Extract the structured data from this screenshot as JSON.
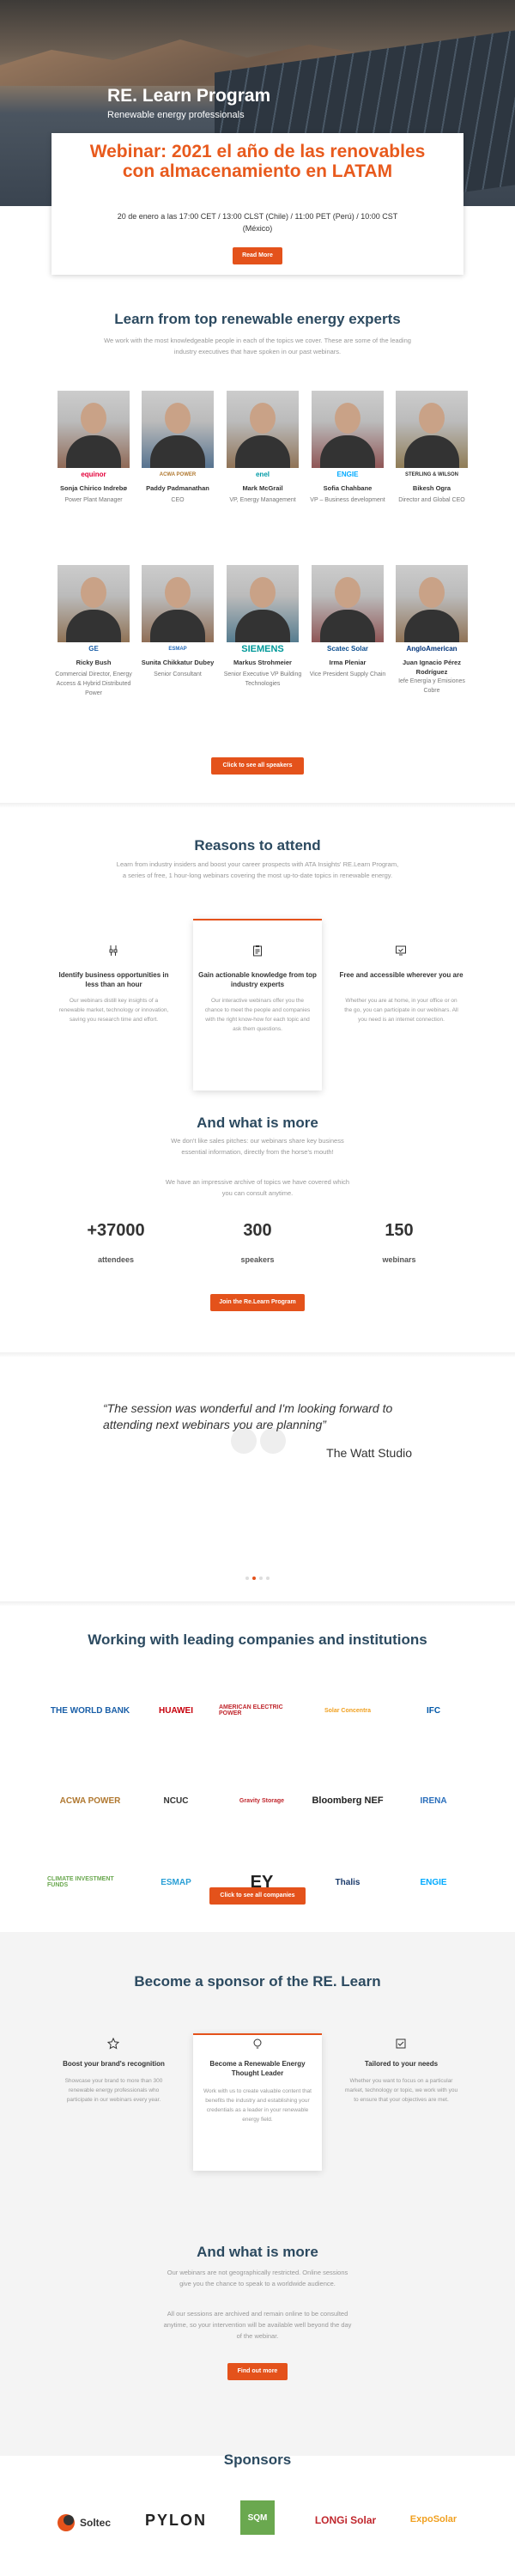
{
  "hero": {
    "title": "RE. Learn Program",
    "subtitle": "Renewable energy professionals"
  },
  "webinar": {
    "title": "Webinar: 2021 el año de las renovables con almacenamiento en LATAM",
    "time": "20 de enero a las 17:00 CET / 13:00 CLST (Chile) / 11:00 PET (Perú) / 10:00 CST (México)",
    "cta": "Read More"
  },
  "experts": {
    "title": "Learn from top renewable energy experts",
    "desc": "We work with the most knowledgeable people in each of the topics we cover. These are some of the leading industry executives that have spoken in our past webinars.",
    "cta": "Click to see all speakers",
    "row1": [
      {
        "name": "Sonja Chirico Indrebø",
        "role": "Power Plant Manager",
        "logo": "equinor"
      },
      {
        "name": "Paddy Padmanathan",
        "role": "CEO",
        "logo": "ACWA POWER"
      },
      {
        "name": "Mark McGrail",
        "role": "VP, Energy Management",
        "logo": "enel"
      },
      {
        "name": "Sofia Chahbane",
        "role": "VP – Business development",
        "logo": "ENGIE"
      },
      {
        "name": "Bikesh Ogra",
        "role": "Director and Global CEO",
        "logo": "STERLING & WILSON"
      }
    ],
    "row2": [
      {
        "name": "Ricky Bush",
        "role": "Commercial Director, Energy Access & Hybrid Distributed Power",
        "logo": "GE"
      },
      {
        "name": "Sunita Chikkatur Dubey",
        "role": "Senior Consultant",
        "logo": "ESMAP"
      },
      {
        "name": "Markus Strohmeier",
        "role": "Senior Executive VP Building Technologies",
        "logo": "SIEMENS"
      },
      {
        "name": "Irma Pleniar",
        "role": "Vice President Supply Chain",
        "logo": "Scatec Solar"
      },
      {
        "name": "Juan Ignacio Pérez Rodríguez",
        "role": "Iefe Energía y Emisiones Cobre",
        "logo": "AngloAmerican"
      }
    ]
  },
  "reasons": {
    "title": "Reasons to attend",
    "desc": "Learn from industry insiders and boost your career prospects with ATA Insights' RE.Learn Program, a series of free, 1 hour-long webinars covering the most up-to-date topics in renewable energy.",
    "cards": [
      {
        "icon": "cables-icon",
        "title": "Identify business opportunities in less than an hour",
        "desc": "Our webinars distill key insights of a renewable market, technology or innovation, saving you research time and effort."
      },
      {
        "icon": "clipboard-icon",
        "title": "Gain actionable knowledge from top industry experts",
        "desc": "Our interactive webinars offer you the chance to meet the people and companies with the right know-how for each topic and ask them questions."
      },
      {
        "icon": "monitor-check-icon",
        "title": "Free and accessible wherever you are",
        "desc": "Whether you are at home, in your office or on the go, you can participate in our webinars. All you need is an internet connection."
      }
    ]
  },
  "more": {
    "title": "And what is more",
    "desc1": "We don't like sales pitches: our webinars share key business essential information, directly from the horse's mouth!",
    "desc2": "We have an impressive archive of topics we have covered which you can consult anytime.",
    "cta": "Join the Re.Learn Program",
    "stats": [
      {
        "n": "+37000",
        "l": "attendees"
      },
      {
        "n": "300",
        "l": "speakers"
      },
      {
        "n": "150",
        "l": "webinars"
      }
    ]
  },
  "quote": {
    "text": "“The session was wonderful and I'm looking forward to attending next webinars you are planning”",
    "author": "The Watt Studio"
  },
  "companies": {
    "title": "Working with leading companies and institutions",
    "cta": "Click to see all companies",
    "logos": [
      [
        "THE WORLD BANK",
        "HUAWEI",
        "AMERICAN ELECTRIC POWER",
        "Solar Concentra",
        "IFC"
      ],
      [
        "ACWA POWER",
        "NCUC",
        "Gravity Storage",
        "Bloomberg NEF",
        "IRENA"
      ],
      [
        "CLIMATE INVESTMENT FUNDS",
        "ESMAP",
        "EY",
        "Thalis",
        "ENGIE"
      ]
    ]
  },
  "sponsor": {
    "title": "Become a sponsor of the RE. Learn",
    "cards": [
      {
        "icon": "star-icon",
        "title": "Boost your brand's recognition",
        "desc": "Showcase your brand to more than 300 renewable energy professionals who participate in our webinars every year."
      },
      {
        "icon": "lightbulb-icon",
        "title": "Become a Renewable Energy Thought Leader",
        "desc": "Work with us to create valuable content that benefits the industry and establishing your credentials as a leader in your renewable energy field."
      },
      {
        "icon": "checklist-icon",
        "title": "Tailored to your needs",
        "desc": "Whether you want to focus on a particular market, technology or topic, we work with you to ensure that your objectives are met."
      }
    ]
  },
  "more2": {
    "title": "And what is more",
    "desc1": "Our webinars are not geographically restricted. Online sessions give you the chance to speak to a worldwide audience.",
    "desc2": "All our sessions are archived and remain online to be consulted anytime, so your intervention will be available well beyond the day of the webinar.",
    "cta": "Find out more"
  },
  "sponsors": {
    "title": "Sponsors",
    "logos": [
      "Soltec",
      "PYLON",
      "SQM",
      "LONGi Solar",
      "ExpoSolar"
    ]
  },
  "colors": {
    "accent": "#e4521b",
    "heading": "#2c4a60"
  }
}
